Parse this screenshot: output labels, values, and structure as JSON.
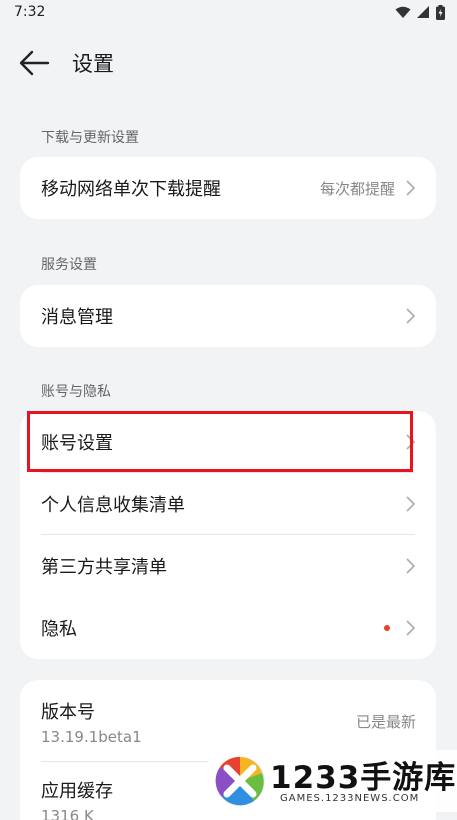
{
  "status_bar": {
    "time": "7:32"
  },
  "header": {
    "title": "设置"
  },
  "sections": {
    "download": {
      "label": "下载与更新设置",
      "row_mobile_download": {
        "label": "移动网络单次下载提醒",
        "value": "每次都提醒"
      }
    },
    "service": {
      "label": "服务设置",
      "row_message": {
        "label": "消息管理"
      }
    },
    "account": {
      "label": "账号与隐私",
      "row_account_settings": {
        "label": "账号设置"
      },
      "row_personal_info": {
        "label": "个人信息收集清单"
      },
      "row_third_party": {
        "label": "第三方共享清单"
      },
      "row_privacy": {
        "label": "隐私"
      }
    },
    "about": {
      "row_version": {
        "label": "版本号",
        "sub": "13.19.1beta1",
        "value": "已是最新"
      },
      "row_cache": {
        "label": "应用缓存",
        "sub": "1316 K"
      }
    }
  },
  "watermark": {
    "title": "1233手游库",
    "subtitle": "GAMES.1233NEWS.COM"
  },
  "colors": {
    "background": "#f1f3f5",
    "highlight": "#e8141d",
    "dot": "#e8422f"
  }
}
